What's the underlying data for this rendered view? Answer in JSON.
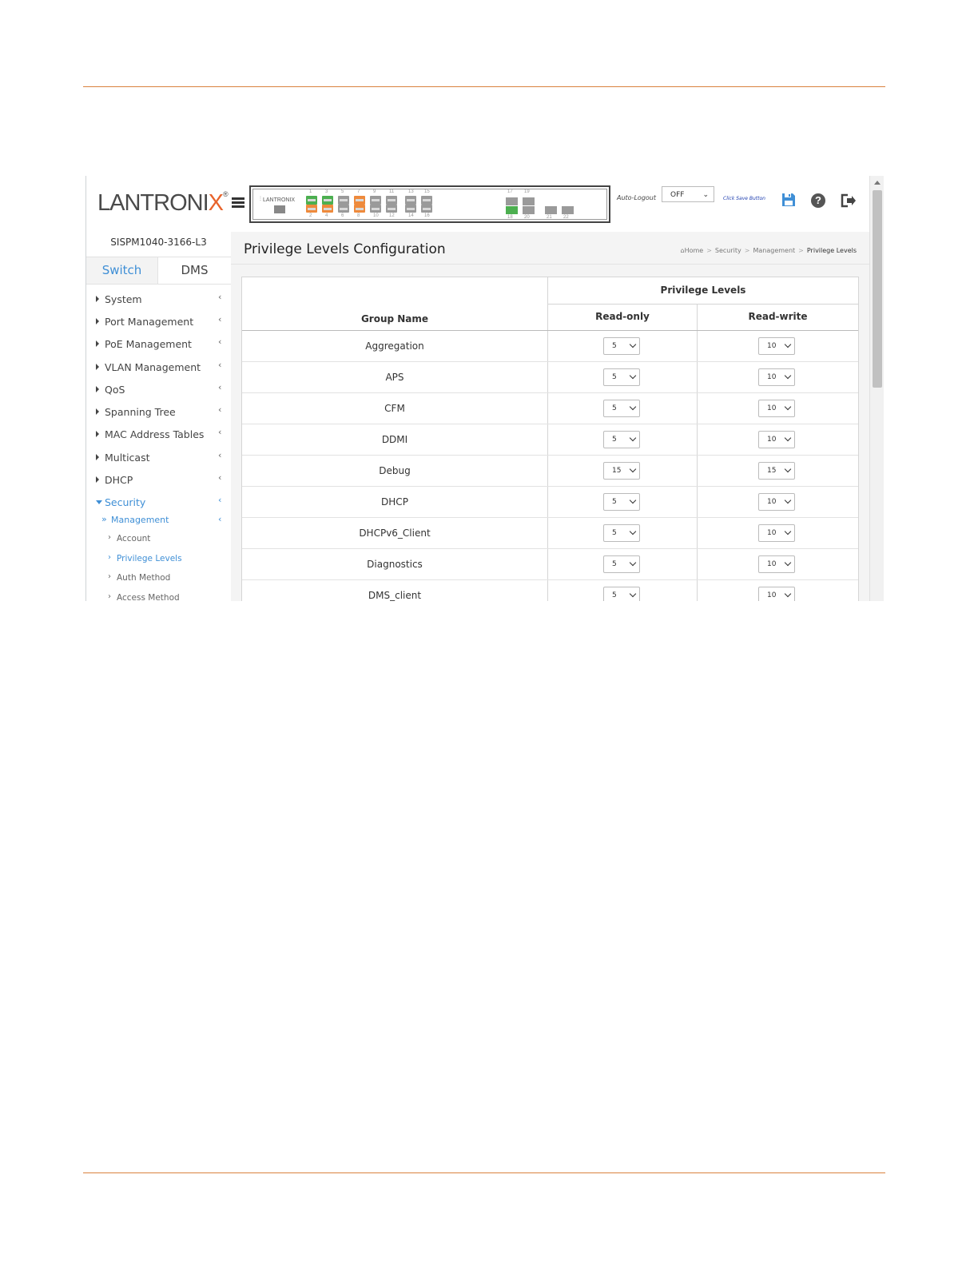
{
  "brand": {
    "logo_main": "LANTRONI",
    "logo_x": "X",
    "logo_reg": "®",
    "panel_logo": "LANTRONIX"
  },
  "header": {
    "auto_logout_label": "Auto-Logout",
    "auto_logout_value": "OFF",
    "click_save_label": "Click Save Button"
  },
  "ports": {
    "top_numbers": [
      "1",
      "3",
      "5",
      "7",
      "9",
      "11",
      "13",
      "15"
    ],
    "bottom_numbers": [
      "2",
      "4",
      "6",
      "8",
      "10",
      "12",
      "14",
      "16"
    ],
    "sfp_top": [
      "17",
      "19"
    ],
    "sfp_bottom": [
      "18",
      "20",
      "21",
      "22"
    ],
    "colors": {
      "active": "#4caf50",
      "poe": "#ee8a3c",
      "idle": "#9a9a9a"
    }
  },
  "sidebar": {
    "device_name": "SISPM1040-3166-L3",
    "tabs": [
      {
        "label": "Switch"
      },
      {
        "label": "DMS"
      }
    ],
    "items": [
      {
        "label": "System"
      },
      {
        "label": "Port Management"
      },
      {
        "label": "PoE Management"
      },
      {
        "label": "VLAN Management"
      },
      {
        "label": "QoS"
      },
      {
        "label": "Spanning Tree"
      },
      {
        "label": "MAC Address Tables"
      },
      {
        "label": "Multicast"
      },
      {
        "label": "DHCP"
      },
      {
        "label": "Security"
      }
    ],
    "submenu": {
      "label": "Management"
    },
    "leaves": [
      {
        "label": "Account"
      },
      {
        "label": "Privilege Levels"
      },
      {
        "label": "Auth Method"
      },
      {
        "label": "Access Method"
      }
    ]
  },
  "main": {
    "title": "Privilege Levels Configuration",
    "breadcrumb": {
      "home": "Home",
      "b1": "Security",
      "b2": "Management",
      "b3": "Privilege Levels"
    },
    "table": {
      "col_group_name": "Group Name",
      "col_privilege_levels": "Privilege Levels",
      "col_read_only": "Read-only",
      "col_read_write": "Read-write",
      "rows": [
        {
          "group": "Aggregation",
          "ro": "5",
          "rw": "10"
        },
        {
          "group": "APS",
          "ro": "5",
          "rw": "10"
        },
        {
          "group": "CFM",
          "ro": "5",
          "rw": "10"
        },
        {
          "group": "DDMI",
          "ro": "5",
          "rw": "10"
        },
        {
          "group": "Debug",
          "ro": "15",
          "rw": "15"
        },
        {
          "group": "DHCP",
          "ro": "5",
          "rw": "10"
        },
        {
          "group": "DHCPv6_Client",
          "ro": "5",
          "rw": "10"
        },
        {
          "group": "Diagnostics",
          "ro": "5",
          "rw": "10"
        },
        {
          "group": "DMS_client",
          "ro": "5",
          "rw": "10"
        }
      ]
    }
  },
  "colors": {
    "accent": "#3f8fd6",
    "doc_rule": "#d9823f",
    "logo_x": "#e8632b"
  }
}
